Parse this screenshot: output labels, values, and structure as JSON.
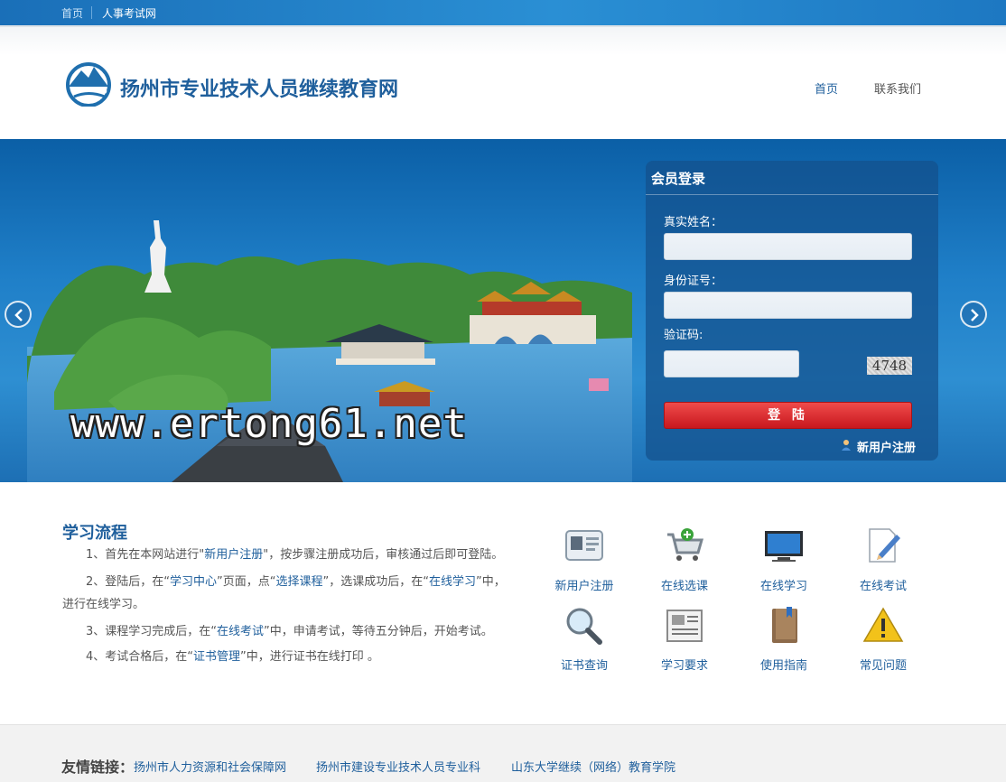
{
  "topbar": {
    "home": "首页",
    "exam_site": "人事考试网"
  },
  "header": {
    "site_title": "扬州市专业技术人员继续教育网",
    "nav": {
      "home": "首页",
      "contact": "联系我们"
    }
  },
  "banner": {
    "watermark": "www.ertong61.net"
  },
  "login": {
    "title": "会员登录",
    "name_label": "真实姓名：",
    "id_label": "身份证号：",
    "captcha_label": "验证码:",
    "captcha_value": "4748",
    "submit": "登 陆",
    "register": "新用户注册"
  },
  "process": {
    "title": "学习流程",
    "step1": {
      "a": "1、首先在本网站进行\"",
      "link": "新用户注册",
      "b": "\"，按步骤注册成功后，审核通过后即可登陆。"
    },
    "step2": {
      "a": "2、登陆后，在“",
      "link1": "学习中心",
      "b": "”页面，点“",
      "link2": "选择课程",
      "c": "”，选课成功后，在“",
      "link3": "在线学习",
      "d": "”中，进行在线学习。"
    },
    "step3": {
      "a": "3、课程学习完成后，在“",
      "link": "在线考试",
      "b": "”中，申请考试，等待五分钟后，开始考试。"
    },
    "step4": {
      "a": "4、考试合格后，在“",
      "link": "证书管理",
      "b": "”中，进行证书在线打印 。"
    }
  },
  "quick_links": [
    {
      "label": "新用户注册",
      "icon": "id-card-icon"
    },
    {
      "label": "在线选课",
      "icon": "shopping-cart-icon"
    },
    {
      "label": "在线学习",
      "icon": "monitor-icon"
    },
    {
      "label": "在线考试",
      "icon": "pencil-paper-icon"
    },
    {
      "label": "证书查询",
      "icon": "magnifier-icon"
    },
    {
      "label": "学习要求",
      "icon": "newspaper-icon"
    },
    {
      "label": "使用指南",
      "icon": "book-icon"
    },
    {
      "label": "常见问题",
      "icon": "warning-icon"
    }
  ],
  "footer": {
    "label": "友情链接：",
    "links": [
      "扬州市人力资源和社会保障网",
      "扬州市建设专业技术人员专业科",
      "山东大学继续（网络）教育学院"
    ]
  },
  "colors": {
    "brand_blue": "#1f5f9c",
    "login_red": "#d42128",
    "topbar_blue": "#1a6fb8"
  }
}
